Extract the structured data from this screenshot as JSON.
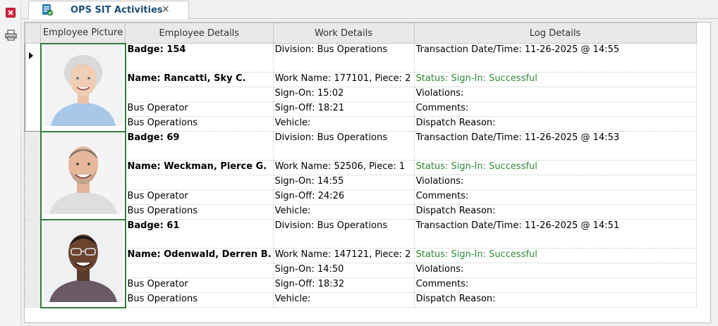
{
  "tab": {
    "title": "OPS SIT Activities",
    "close": "×"
  },
  "columns": [
    "Employee Picture",
    "Employee Details",
    "Work Details",
    "Log Details"
  ],
  "employees": [
    {
      "badge": "Badge: 154",
      "name": "Name: Rancatti, Sky C.",
      "title": "Bus Operator",
      "dept": "Bus Operations",
      "division": "Division: Bus Operations",
      "work_name": "Work Name: 177101, Piece: 2",
      "sign_on": "Sign-On: 15:02",
      "sign_off": "Sign-Off: 18:21",
      "vehicle": "Vehicle:",
      "transaction": "Transaction Date/Time: 11-26-2025 @ 14:55",
      "status": "Status: Sign-In: Successful",
      "violations": "Violations:",
      "comments": "Comments:",
      "dispatch": "Dispatch Reason:"
    },
    {
      "badge": "Badge: 69",
      "name": "Name: Weckman, Pierce G.",
      "title": "Bus Operator",
      "dept": "Bus Operations",
      "division": "Division: Bus Operations",
      "work_name": "Work Name: 52506, Piece: 1",
      "sign_on": "Sign-On: 14:55",
      "sign_off": "Sign-Off: 24:26",
      "vehicle": "Vehicle:",
      "transaction": "Transaction Date/Time: 11-26-2025 @ 14:53",
      "status": "Status: Sign-In: Successful",
      "violations": "Violations:",
      "comments": "Comments:",
      "dispatch": "Dispatch Reason:"
    },
    {
      "badge": "Badge: 61",
      "name": "Name: Odenwald, Derren B.",
      "title": "Bus Operator",
      "dept": "Bus Operations",
      "division": "Division: Bus Operations",
      "work_name": "Work Name: 147121, Piece: 2",
      "sign_on": "Sign-On: 14:50",
      "sign_off": "Sign-Off: 18:32",
      "vehicle": "Vehicle:",
      "transaction": "Transaction Date/Time: 11-26-2025 @ 14:51",
      "status": "Status: Sign-In: Successful",
      "violations": "Violations:",
      "comments": "Comments:",
      "dispatch": "Dispatch Reason:"
    }
  ],
  "colors": {
    "status_green": "#2a8a32",
    "photo_border": "#2f7d3a",
    "tab_title": "#1a4f7a",
    "close_red": "#d9263a"
  },
  "icons": {
    "close": "close-icon",
    "print": "printer-icon",
    "tab": "activity-document-icon",
    "row_pointer": "row-indicator-icon"
  }
}
